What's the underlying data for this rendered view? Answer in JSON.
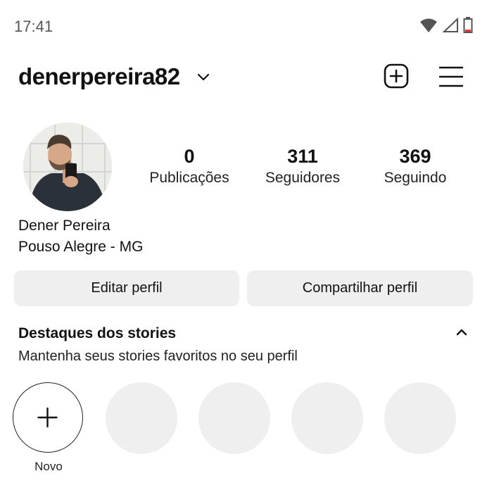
{
  "status_bar": {
    "time": "17:41",
    "icons": [
      "wifi-icon",
      "signal-icon",
      "battery-icon"
    ]
  },
  "header": {
    "username": "denerpereira82",
    "icons": [
      "chevron-down-icon",
      "add-post-icon",
      "menu-icon"
    ]
  },
  "profile": {
    "stats": [
      {
        "value": "0",
        "label": "Publicações"
      },
      {
        "value": "311",
        "label": "Seguidores"
      },
      {
        "value": "369",
        "label": "Seguindo"
      }
    ],
    "name": "Dener Pereira",
    "location": "Pouso Alegre - MG"
  },
  "buttons": {
    "edit": "Editar perfil",
    "share": "Compartilhar perfil"
  },
  "highlights": {
    "title": "Destaques dos stories",
    "subtitle": "Mantenha seus stories favoritos no seu perfil",
    "new_label": "Novo"
  },
  "colors": {
    "background": "#ffffff",
    "button_bg": "#efefef",
    "text": "#111111",
    "battery_low": "#e53935"
  }
}
